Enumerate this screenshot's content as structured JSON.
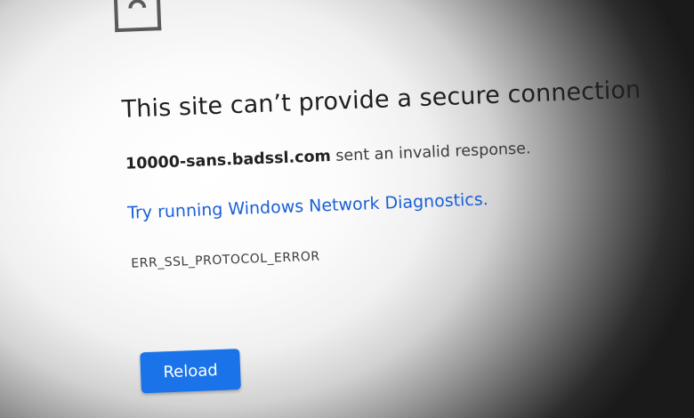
{
  "error_page": {
    "icon": "sad-page-icon",
    "title": "This site can’t provide a secure connection",
    "host": "10000-sans.badssl.com",
    "detail_suffix": " sent an invalid response.",
    "diagnostics_link": "Try running Windows Network Diagnostics.",
    "error_code": "ERR_SSL_PROTOCOL_ERROR",
    "reload_label": "Reload"
  },
  "colors": {
    "link": "#1a5fd6",
    "button": "#1a73e8",
    "title": "#1f1f1f",
    "text": "#3c3c3c"
  }
}
